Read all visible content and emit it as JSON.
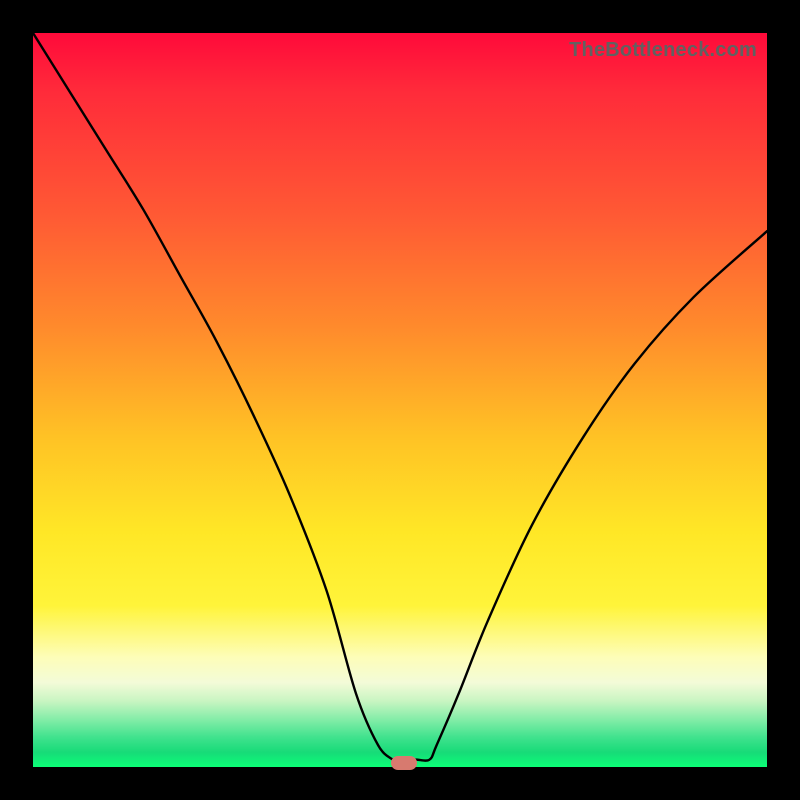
{
  "watermark": "TheBottleneck.com",
  "colors": {
    "frame": "#000000",
    "gradient_top": "#ff0a3a",
    "gradient_mid": "#ffe726",
    "gradient_bottom": "#0cff77",
    "curve": "#000000",
    "marker": "#d77a6f"
  },
  "chart_data": {
    "type": "line",
    "title": "",
    "xlabel": "",
    "ylabel": "",
    "xlim": [
      0,
      100
    ],
    "ylim": [
      0,
      100
    ],
    "grid": false,
    "legend": false,
    "annotations": [
      "TheBottleneck.com"
    ],
    "series": [
      {
        "name": "bottleneck-curve",
        "x": [
          0,
          5,
          10,
          15,
          20,
          25,
          30,
          35,
          40,
          44,
          47,
          49,
          50,
          51,
          52,
          54,
          55,
          58,
          62,
          68,
          75,
          82,
          90,
          100
        ],
        "values": [
          100,
          92,
          84,
          76,
          67,
          58,
          48,
          37,
          24,
          10,
          3,
          1,
          0.5,
          0.5,
          1,
          1,
          3,
          10,
          20,
          33,
          45,
          55,
          64,
          73
        ]
      }
    ],
    "marker": {
      "x": 50.5,
      "y": 0.5
    }
  }
}
